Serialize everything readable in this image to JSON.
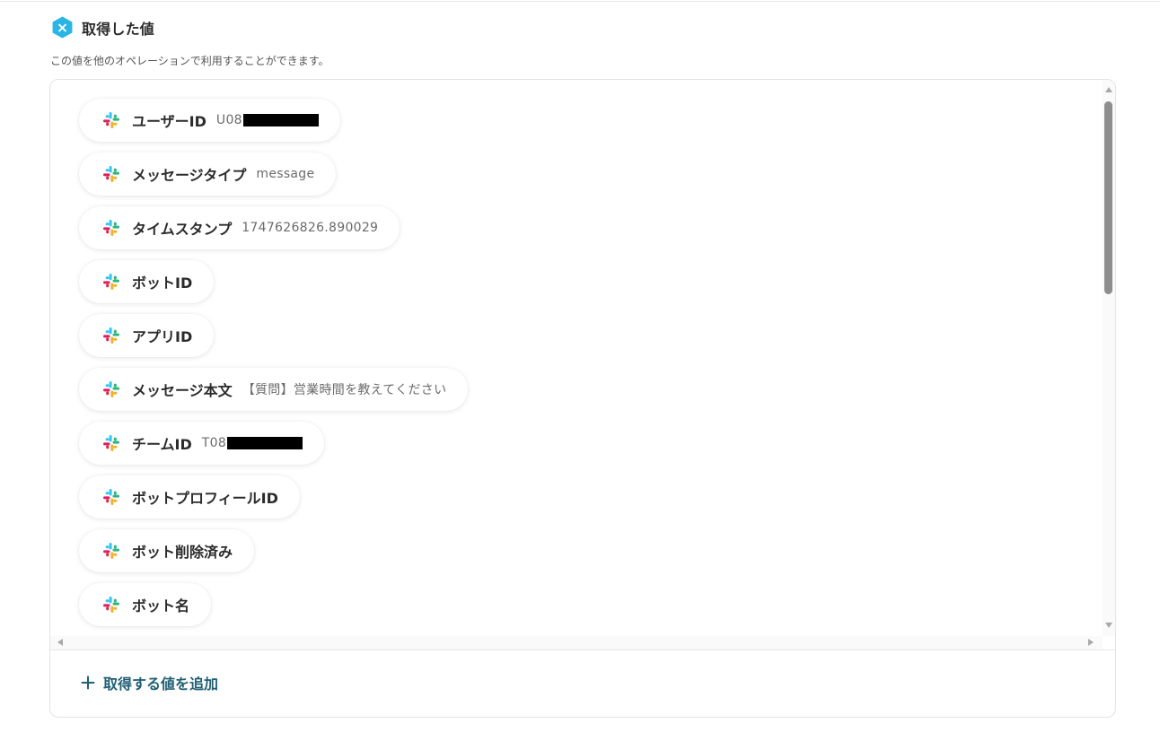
{
  "header": {
    "title": "取得した値",
    "description": "この値を他のオペレーションで利用することができます。",
    "icon": "x-hexagon-icon",
    "accent_color": "#2bb4e6"
  },
  "items": [
    {
      "label": "ユーザーID",
      "value": "U08",
      "redacted": true
    },
    {
      "label": "メッセージタイプ",
      "value": "message",
      "redacted": false
    },
    {
      "label": "タイムスタンプ",
      "value": "1747626826.890029",
      "redacted": false
    },
    {
      "label": "ボットID",
      "value": "",
      "redacted": false
    },
    {
      "label": "アプリID",
      "value": "",
      "redacted": false
    },
    {
      "label": "メッセージ本文",
      "value": "【質問】営業時間を教えてください",
      "redacted": false
    },
    {
      "label": "チームID",
      "value": "T08",
      "redacted": true
    },
    {
      "label": "ボットプロフィールID",
      "value": "",
      "redacted": false
    },
    {
      "label": "ボット削除済み",
      "value": "",
      "redacted": false
    },
    {
      "label": "ボット名",
      "value": "",
      "redacted": false
    }
  ],
  "item_icon": "slack-icon",
  "footer": {
    "add_label": "取得する値を追加",
    "add_color": "#1f5f73"
  }
}
